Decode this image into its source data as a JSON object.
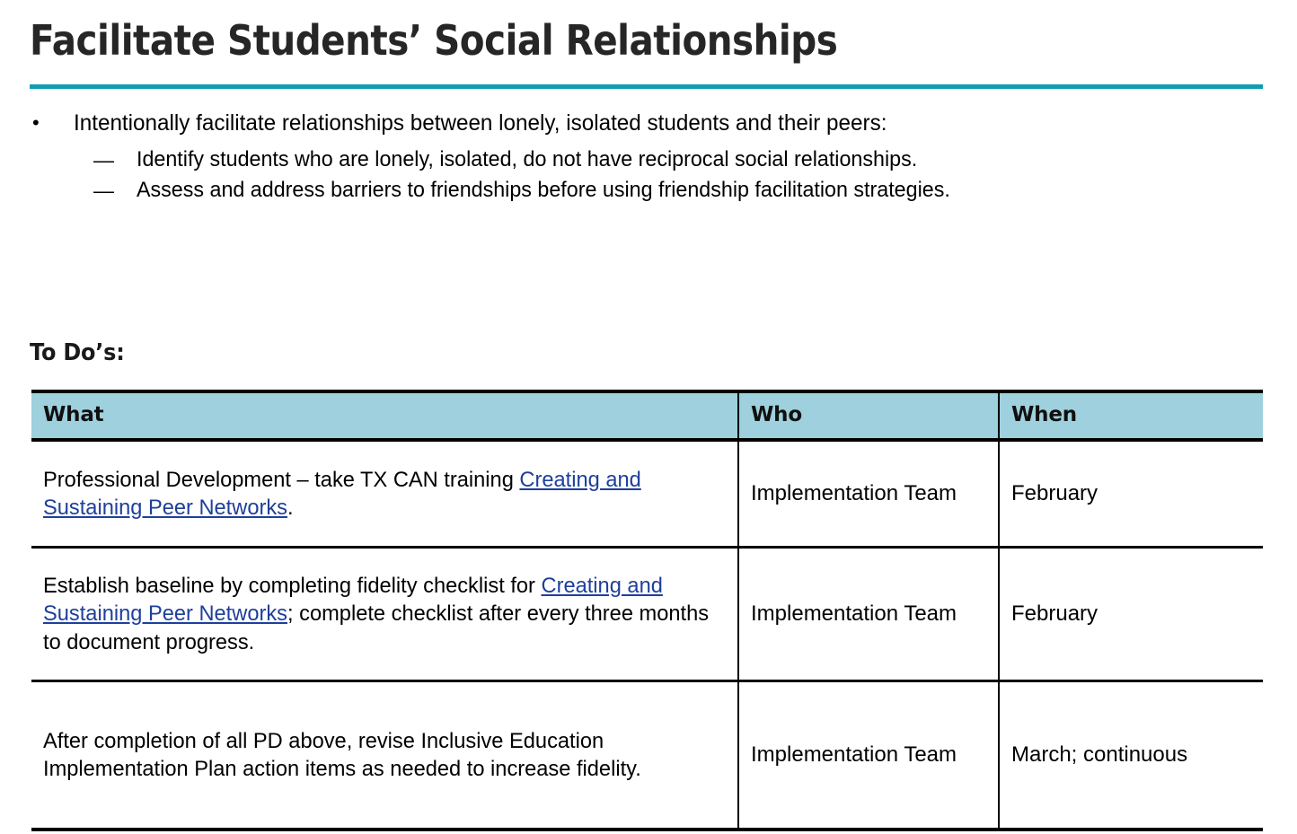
{
  "slide": {
    "title": "Facilitate Students’ Social Relationships",
    "accent_color": "#0f9eb0",
    "title_color": "#262626"
  },
  "bullets": {
    "level1_marker": "•",
    "level2_marker": "—",
    "items": [
      {
        "level": 1,
        "text": "Intentionally facilitate relationships between lonely, isolated students and their peers:"
      },
      {
        "level": 2,
        "text": "Identify students who are lonely, isolated, do not have reciprocal social relationships."
      },
      {
        "level": 2,
        "text": "Assess and address barriers to friendships before using friendship facilitation strategies."
      }
    ]
  },
  "todo": {
    "heading": "To Do’s:",
    "header_bg": "#9ed0dd",
    "link_color": "#1e3f9c",
    "columns": [
      "What",
      "Who",
      "When"
    ],
    "rows": [
      {
        "what_pre": "Professional Development – take TX CAN training ",
        "what_link": "Creating and Sustaining Peer Networks",
        "what_post": ".",
        "who": "Implementation Team",
        "when": "February"
      },
      {
        "what_pre": "Establish baseline by completing fidelity checklist for ",
        "what_link": "Creating and Sustaining Peer Networks",
        "what_post": "; complete checklist after every three months to document progress.",
        "who": "Implementation Team",
        "when": "February"
      },
      {
        "what_pre": "After completion of all PD above, revise Inclusive Education Implementation Plan action items as needed to increase fidelity.",
        "what_link": "",
        "what_post": "",
        "who": "Implementation Team",
        "when": "March; continuous"
      }
    ]
  }
}
